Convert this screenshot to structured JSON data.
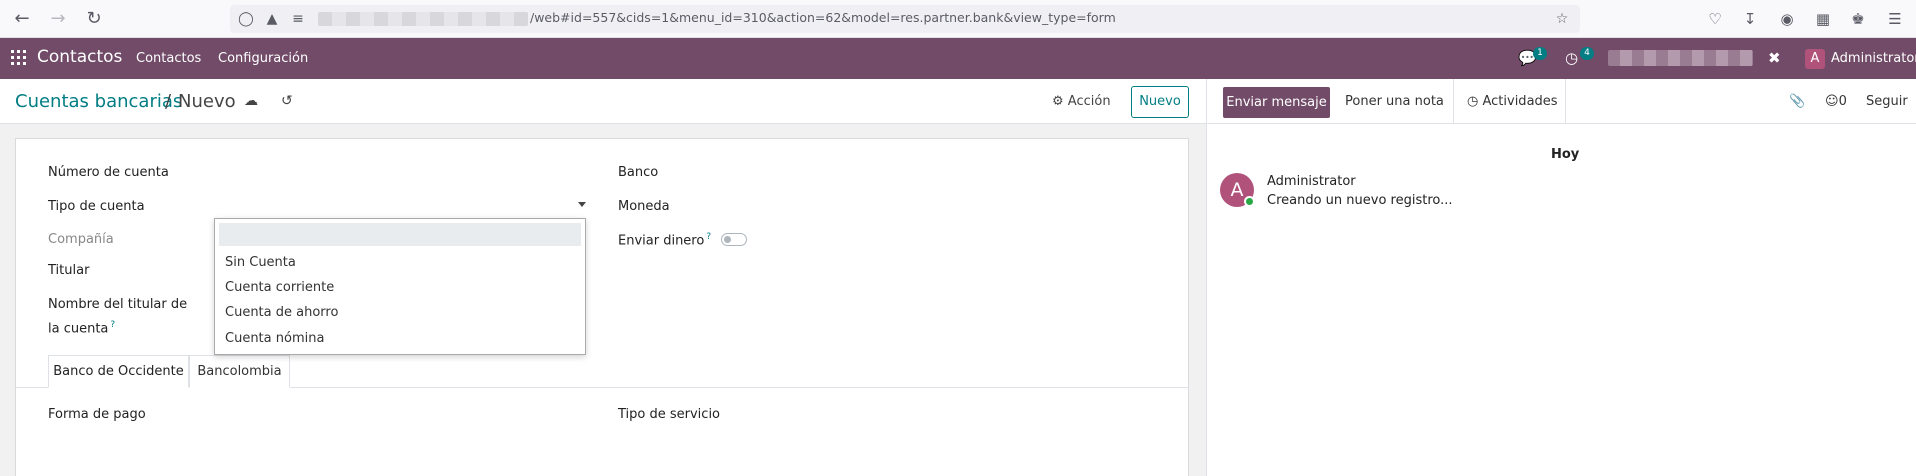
{
  "browser": {
    "url": "/web#id=557&cids=1&menu_id=310&action=62&model=res.partner.bank&view_type=form"
  },
  "navbar": {
    "app_name": "Contactos",
    "menu": [
      "Contactos",
      "Configuración"
    ],
    "messages_count": "1",
    "activities_count": "4",
    "user_initial": "A",
    "user_name": "Administrator"
  },
  "control_panel": {
    "breadcrumb_parent": "Cuentas bancarias",
    "breadcrumb_sep": "/",
    "breadcrumb_current": "Nuevo",
    "action_label": "Acción",
    "new_button": "Nuevo"
  },
  "form": {
    "left_labels": {
      "account_number": "Número de cuenta",
      "account_type": "Tipo de cuenta",
      "company": "Compañía",
      "holder": "Titular",
      "holder_name": "Nombre del titular de la cuenta"
    },
    "right_labels": {
      "bank": "Banco",
      "currency": "Moneda",
      "send_money": "Enviar dinero"
    },
    "help_mark": "?",
    "dropdown_options": [
      "",
      "Sin Cuenta",
      "Cuenta corriente",
      "Cuenta de ahorro",
      "Cuenta nómina"
    ],
    "tabs": [
      "Banco de Occidente",
      "Bancolombia"
    ],
    "tab_fields": {
      "payment_method": "Forma de pago",
      "service_type": "Tipo de servicio"
    }
  },
  "chatter": {
    "send_message": "Enviar mensaje",
    "log_note": "Poner una nota",
    "activities": "Actividades",
    "followers_count": "0",
    "follow": "Seguir",
    "date_separator": "Hoy",
    "message": {
      "author_initial": "A",
      "author": "Administrator",
      "body": "Creando un nuevo registro..."
    }
  },
  "colors": {
    "brand": "#714b67",
    "accent": "#017e84"
  }
}
